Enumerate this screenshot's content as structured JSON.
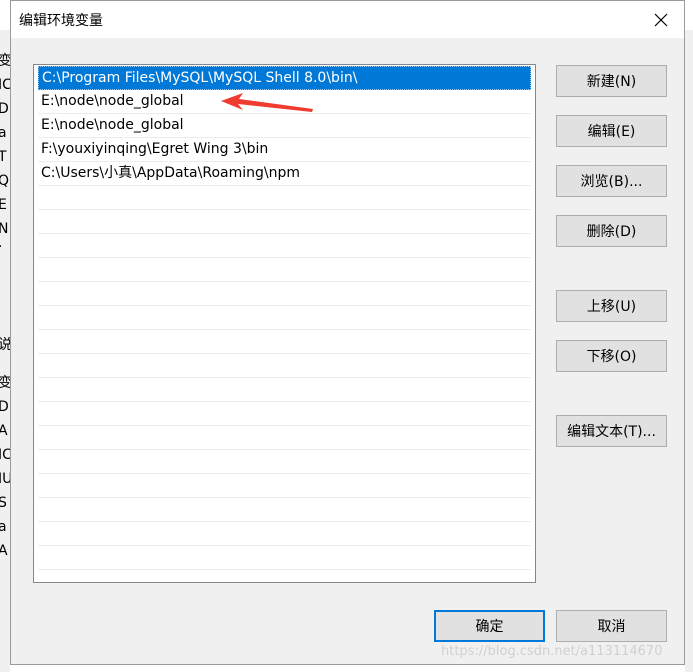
{
  "dialog": {
    "title": "编辑环境变量",
    "close_glyph": "✕"
  },
  "list": {
    "items": [
      {
        "text": "C:\\Program Files\\MySQL\\MySQL Shell 8.0\\bin\\",
        "selected": true
      },
      {
        "text": "E:\\node\\node_global",
        "selected": false
      },
      {
        "text": "E:\\node\\node_global",
        "selected": false
      },
      {
        "text": "F:\\youxiyinqing\\Egret Wing 3\\bin",
        "selected": false
      },
      {
        "text": "C:\\Users\\小真\\AppData\\Roaming\\npm",
        "selected": false
      }
    ]
  },
  "buttons": {
    "new": "新建(N)",
    "edit": "编辑(E)",
    "browse": "浏览(B)...",
    "delete": "删除(D)",
    "move_up": "上移(U)",
    "move_down": "下移(O)",
    "edit_text": "编辑文本(T)...",
    "ok": "确定",
    "cancel": "取消"
  },
  "background_fragments": [
    "变",
    "IC",
    "Dr",
    "a",
    "T",
    "Q",
    "E",
    "N",
    "·",
    "说",
    "变",
    "Dr",
    "A",
    "IC",
    "IU",
    "S",
    "a",
    "A"
  ],
  "watermark": "https://blog.csdn.net/a113114670",
  "colors": {
    "selection": "#0078d7",
    "arrow": "#f03c2e",
    "primary_border": "#0078d7"
  }
}
